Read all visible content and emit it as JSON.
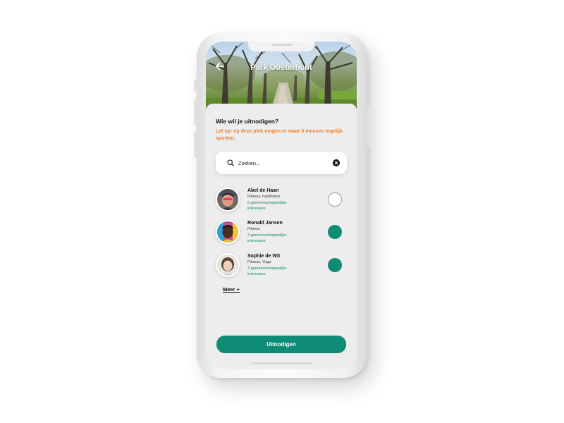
{
  "header": {
    "title": "Park Oosterhout",
    "back_icon": "arrow-left-icon"
  },
  "invite": {
    "question": "Wie wil je uitnodigen?",
    "warning": "Let op: op deze plek mogen er maar 3 mensen tegelijk sporten."
  },
  "search": {
    "placeholder": "Zoeken...",
    "search_icon": "search-icon",
    "clear_icon": "close-circle-icon"
  },
  "people": [
    {
      "name": "Abel de Haan",
      "sports": "Fitness, hardlopen",
      "common": "5 gemeenschappelijke interesses",
      "selected": false
    },
    {
      "name": "Ronald Jansen",
      "sports": "Fitness",
      "common": "3 gemeenschappelijke interesses",
      "selected": true
    },
    {
      "name": "Sophie de Wit",
      "sports": "Fitness, Yoga",
      "common": "3 gemeenschappelijke interesses",
      "selected": true
    }
  ],
  "more_label": "Meer +",
  "invite_button": "Uitnodigen",
  "colors": {
    "accent": "#0f8c75",
    "warning": "#f47b20",
    "background": "#ededed"
  }
}
